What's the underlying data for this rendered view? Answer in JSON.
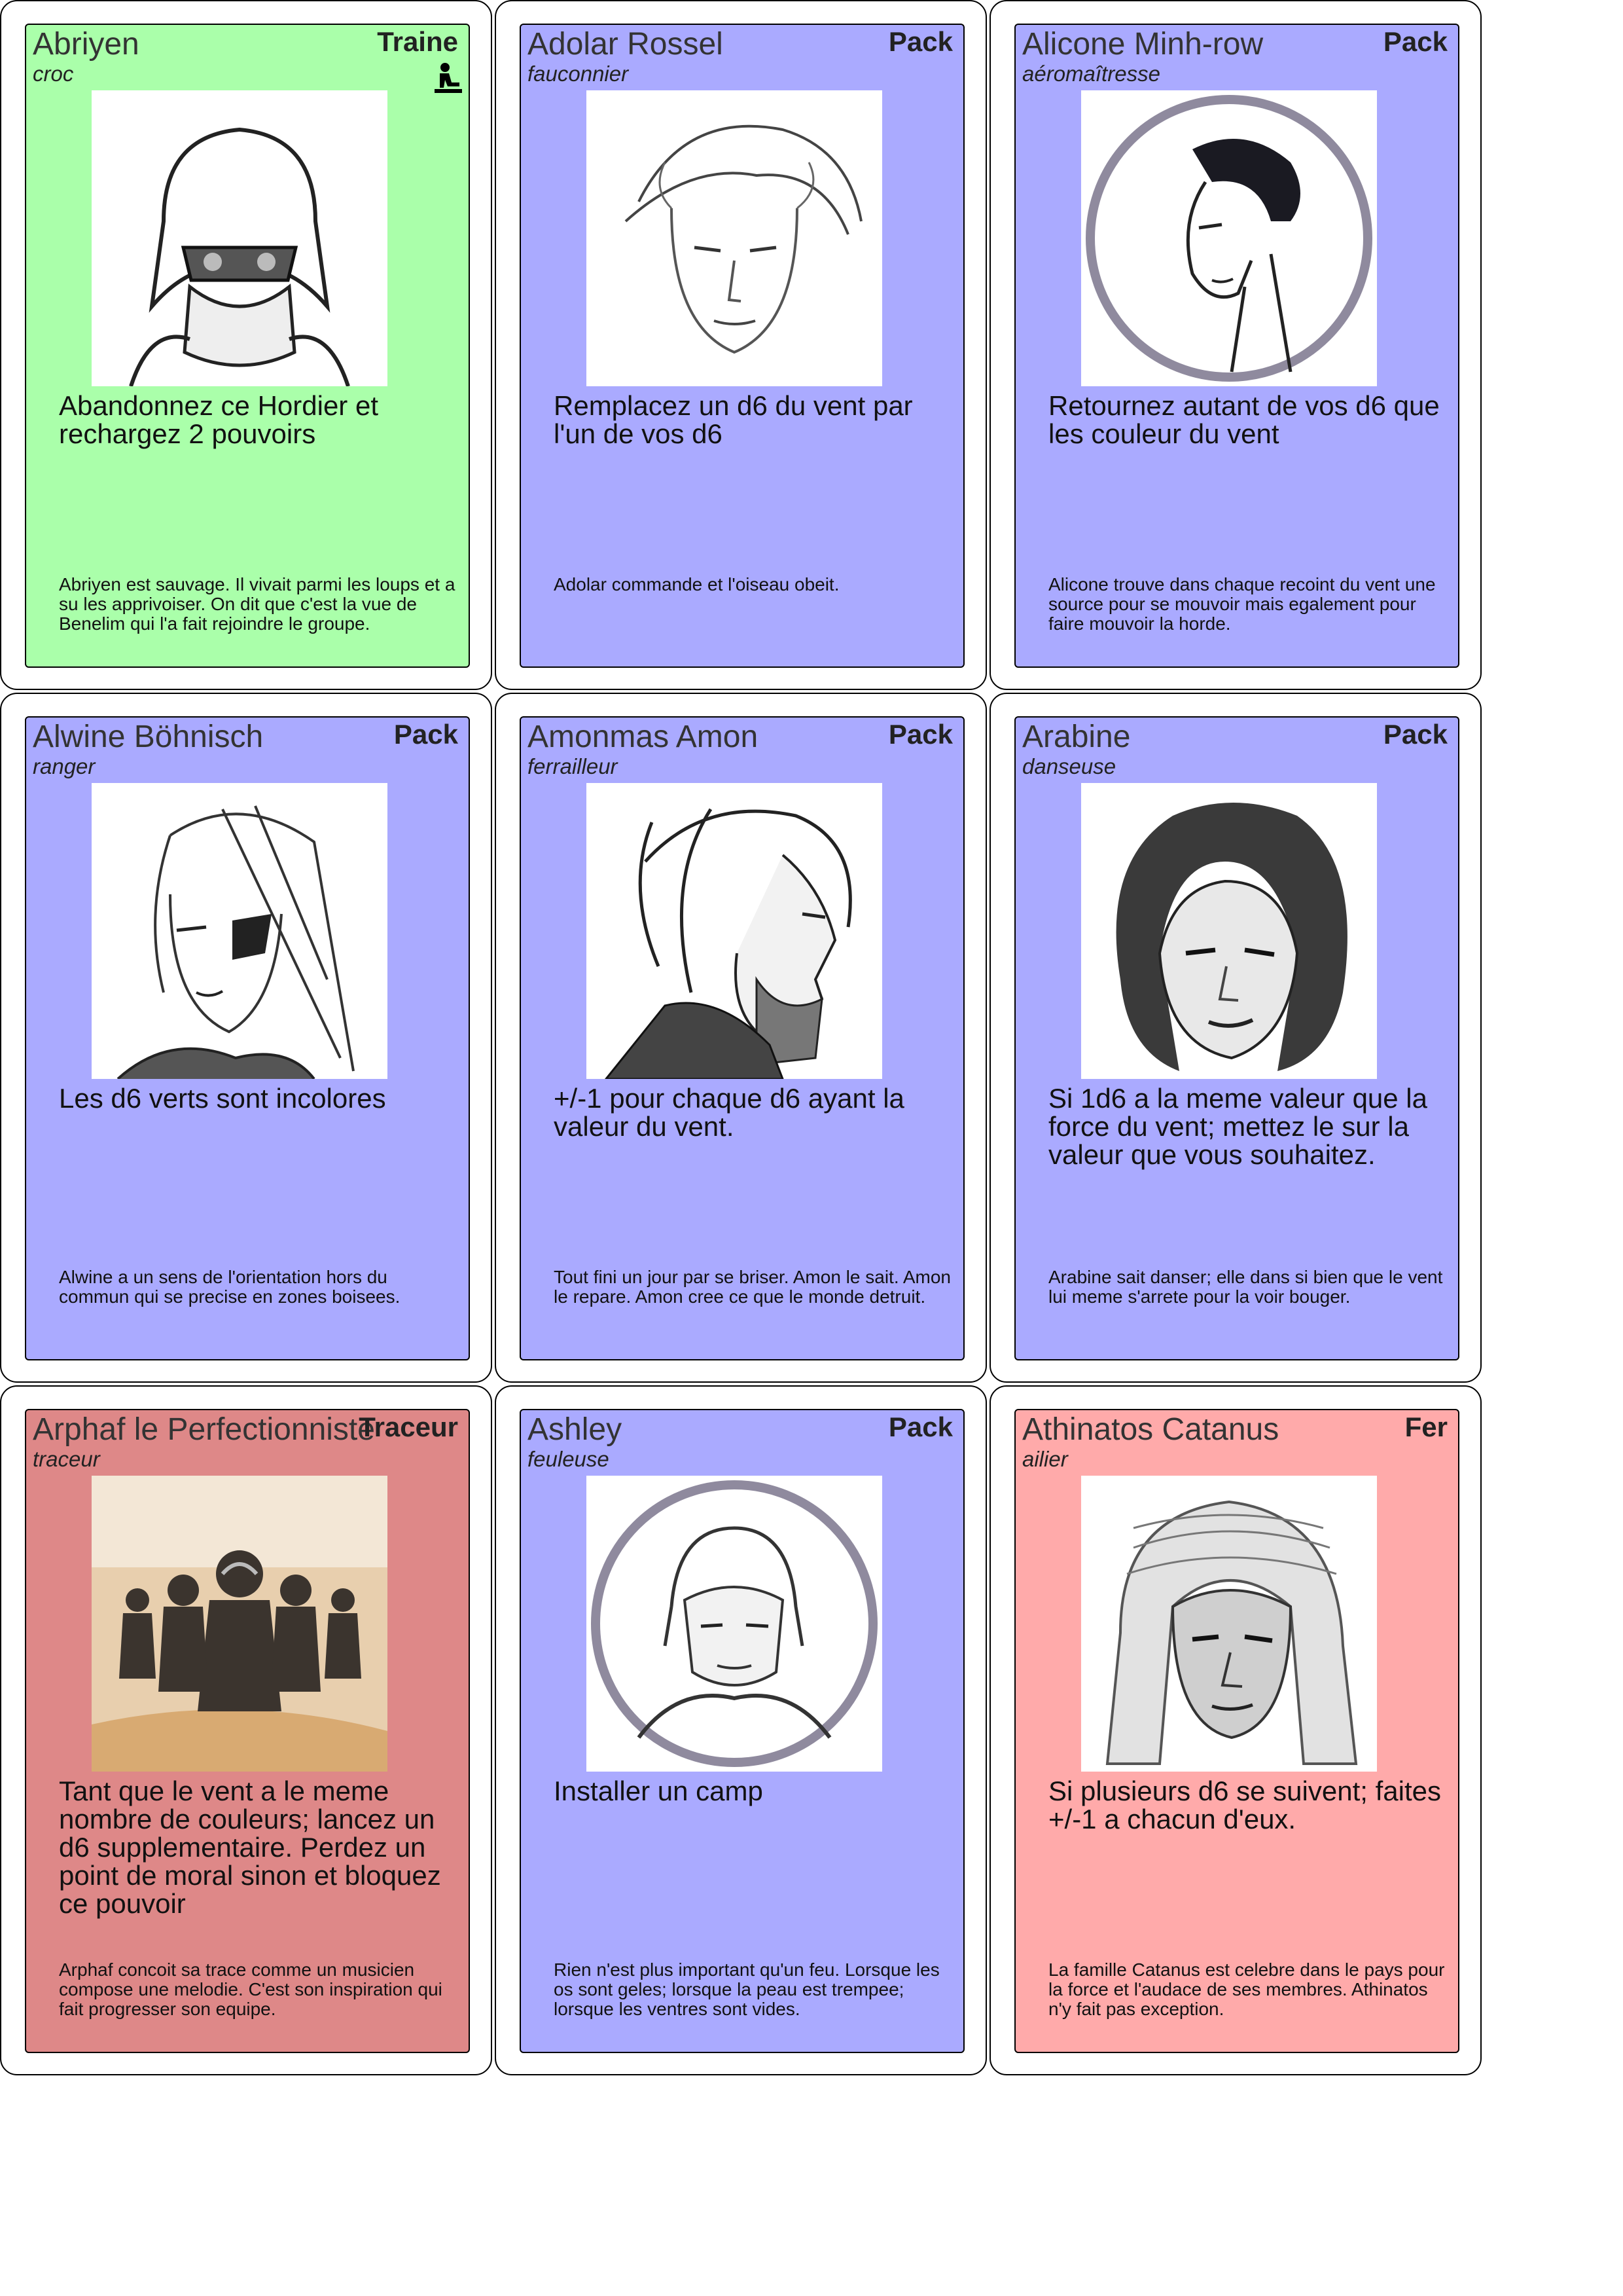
{
  "colors": {
    "traine": "#aaffaa",
    "pack": "#aaaaff",
    "traceur": "#de8888",
    "fer": "#ffaaaa"
  },
  "cards": [
    {
      "name": "Abriyen",
      "role": "croc",
      "faction": "Traine",
      "faction_icon": "sitting-person-icon",
      "effect": "Abandonnez ce Hordier et rechargez 2 pouvoirs",
      "flavor": "Abriyen est sauvage. Il vivait parmi les loups et a su les apprivoiser. On dit que c'est la vue de Benelim qui l'a fait rejoindre le groupe."
    },
    {
      "name": "Adolar Rossel",
      "role": "fauconnier",
      "faction": "Pack",
      "effect": "Remplacez un d6 du vent par l'un de vos d6",
      "flavor": "Adolar commande et l'oiseau obeit."
    },
    {
      "name": "Alicone Minh-row",
      "role": "aéromaîtresse",
      "faction": "Pack",
      "effect": "Retournez autant de vos d6 que les couleur du vent",
      "flavor": "Alicone trouve dans chaque recoint du vent une source pour se mouvoir mais egalement pour faire mouvoir la horde."
    },
    {
      "name": "Alwine Böhnisch",
      "role": "ranger",
      "faction": "Pack",
      "effect": "Les d6 verts sont incolores",
      "flavor": "Alwine a un sens de l'orientation hors du commun qui se precise en zones boisees."
    },
    {
      "name": "Amonmas Amon",
      "role": "ferrailleur",
      "faction": "Pack",
      "effect": "+/-1 pour chaque d6 ayant la valeur du vent.",
      "flavor": "Tout fini un jour par se briser. Amon le sait. Amon le repare. Amon cree ce que le monde detruit."
    },
    {
      "name": "Arabine",
      "role": "danseuse",
      "faction": "Pack",
      "effect": "Si 1d6 a la meme valeur que la force du vent; mettez le sur la valeur que vous souhaitez.",
      "flavor": "Arabine sait danser; elle dans si bien que le vent lui meme s'arrete pour la voir bouger."
    },
    {
      "name": "Arphaf le Perfectionniste",
      "role": "traceur",
      "faction": "Traceur",
      "effect": "Tant que le vent a le meme nombre de couleurs; lancez un d6 supplementaire. Perdez un point de moral sinon et bloquez ce pouvoir",
      "flavor": "Arphaf concoit sa trace comme un musicien compose une melodie. C'est son inspiration qui fait progresser son equipe."
    },
    {
      "name": "Ashley",
      "role": "feuleuse",
      "faction": "Pack",
      "effect": "Installer un camp",
      "flavor": "Rien n'est plus important qu'un feu. Lorsque les os sont geles; lorsque la peau est trempee; lorsque les ventres sont vides."
    },
    {
      "name": "Athinatos Catanus",
      "role": "ailier",
      "faction": "Fer",
      "effect": "Si plusieurs d6 se suivent; faites +/-1 a chacun d'eux.",
      "flavor": "La famille Catanus est celebre dans le pays pour la force et l'audace de ses membres. Athinatos n'y fait pas exception."
    }
  ]
}
